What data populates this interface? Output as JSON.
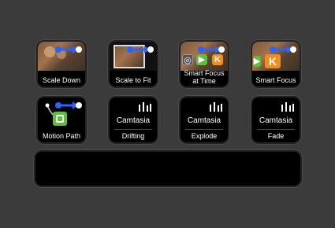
{
  "keys": [
    {
      "label": "Scale Down"
    },
    {
      "label": "Scale to Fit"
    },
    {
      "label": "Smart Focus at Time"
    },
    {
      "label": "Smart Focus"
    },
    {
      "label": "Motion Path"
    },
    {
      "label": "Drifting",
      "brand": "Camtasia"
    },
    {
      "label": "Explode",
      "brand": "Camtasia"
    },
    {
      "label": "Fade",
      "brand": "Camtasia"
    }
  ],
  "tile_letters": {
    "k": "K"
  },
  "colors": {
    "arrow_blue": "#2a63ff",
    "tile_green": "#5fbf3d",
    "tile_orange": "#f28c1b",
    "background": "#3b3b3b"
  },
  "icons": [
    "arrow-dot-icon",
    "motion-path-icon",
    "drift-bars-icon"
  ]
}
